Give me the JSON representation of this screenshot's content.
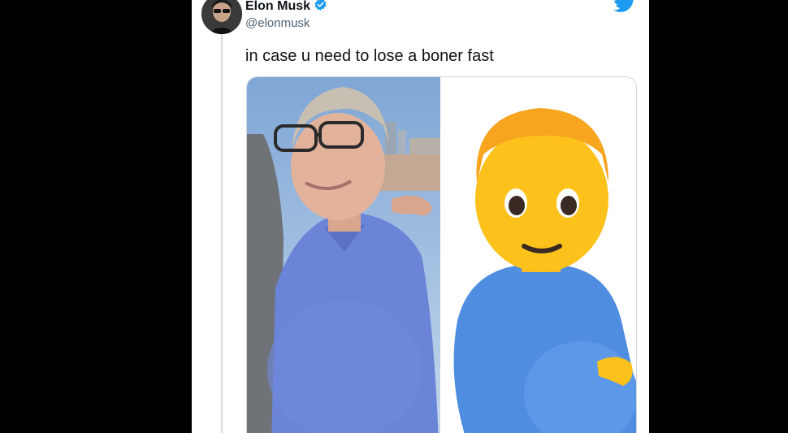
{
  "tweet": {
    "author_name": "Elon Musk",
    "author_handle": "@elonmusk",
    "verified": true,
    "text": "in case u need to lose a boner fast",
    "icons": [
      "avatar",
      "verified-badge-icon",
      "twitter-bird-icon"
    ],
    "media": {
      "left_image": "photo of a smiling man with glasses in a blue polo shirt",
      "right_image": "pregnant man emoji in a blue shirt"
    }
  },
  "colors": {
    "twitter_blue": "#1d9bf0",
    "text_primary": "#0f1419",
    "text_secondary": "#536471",
    "border": "#cfd9de",
    "backdrop": "#000000"
  }
}
